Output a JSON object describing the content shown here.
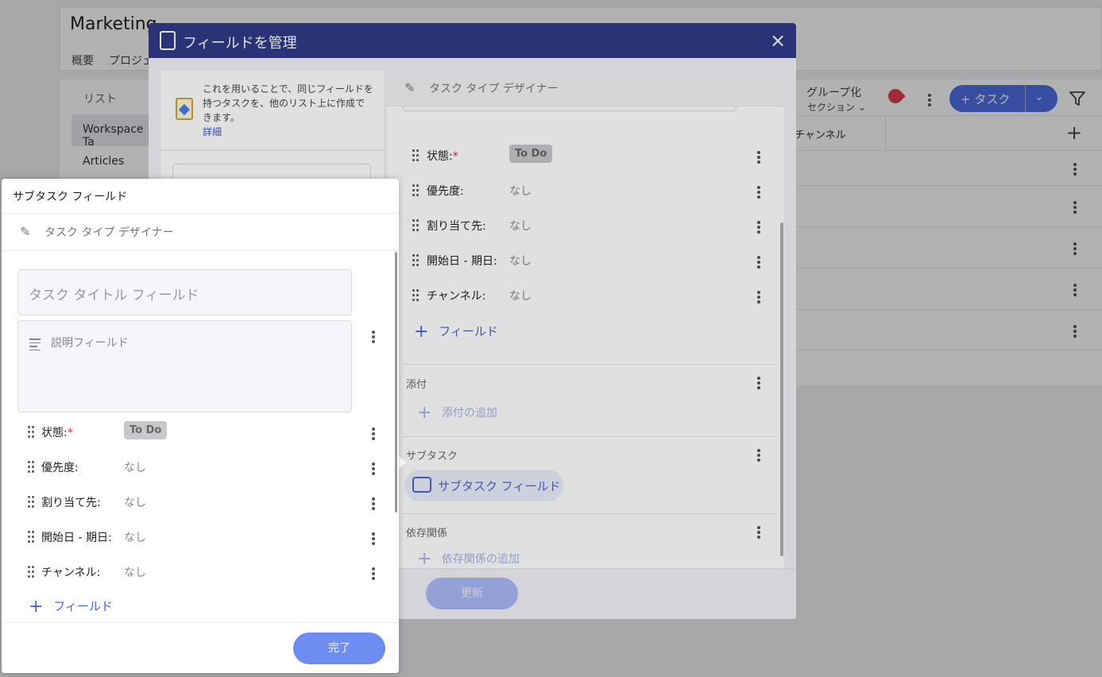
{
  "background": {
    "workspace_title": "Marketing",
    "tabs": [
      "概要",
      "プロジェ"
    ],
    "lists_label": "リスト",
    "lists": [
      "Workspace Ta",
      "Articles"
    ],
    "group_label": "グループ化",
    "section_label": "セクション ⌄",
    "add_task_label": "+ タスク",
    "channel_column": "チャンネル"
  },
  "modal": {
    "title": "フィールドを管理",
    "info_text": "これを用いることで、同じフィールドを持つタスクを、他のリスト上に作成できます。",
    "info_link": "詳細",
    "designer_label": "タスク タイプ デザイナー",
    "fields": [
      {
        "label": "状態:",
        "required": "*",
        "value": "To Do",
        "type": "pill"
      },
      {
        "label": "優先度:",
        "required": "",
        "value": "なし",
        "type": "text"
      },
      {
        "label": "割り当て先:",
        "required": "",
        "value": "なし",
        "type": "text"
      },
      {
        "label": "開始日 - 期日:",
        "required": "",
        "value": "なし",
        "type": "text"
      },
      {
        "label": "チャンネル:",
        "required": "",
        "value": "なし",
        "type": "text"
      }
    ],
    "add_field_label": "フィールド",
    "attachments_title": "添付",
    "add_attachment_label": "添付の追加",
    "subtask_title": "サブタスク",
    "subtask_chip_label": "サブタスク フィールド",
    "dependency_title": "依存関係",
    "add_dependency_label": "依存関係の追加",
    "update_button": "更新"
  },
  "panel": {
    "title": "サブタスク フィールド",
    "designer_label": "タスク タイプ デザイナー",
    "title_field_placeholder": "タスク タイトル フィールド",
    "description_placeholder": "説明フィールド",
    "fields": [
      {
        "label": "状態:",
        "required": "*",
        "value": "To Do",
        "type": "pill"
      },
      {
        "label": "優先度:",
        "required": "",
        "value": "なし",
        "type": "text"
      },
      {
        "label": "割り当て先:",
        "required": "",
        "value": "なし",
        "type": "text"
      },
      {
        "label": "開始日 - 期日:",
        "required": "",
        "value": "なし",
        "type": "text"
      },
      {
        "label": "チャンネル:",
        "required": "",
        "value": "なし",
        "type": "text"
      }
    ],
    "add_field_label": "フィールド",
    "done_button": "完了"
  },
  "colors": {
    "modal_header": "#2f3b86",
    "accent": "#4a63d3",
    "primary_button": "#6f8cf2"
  }
}
